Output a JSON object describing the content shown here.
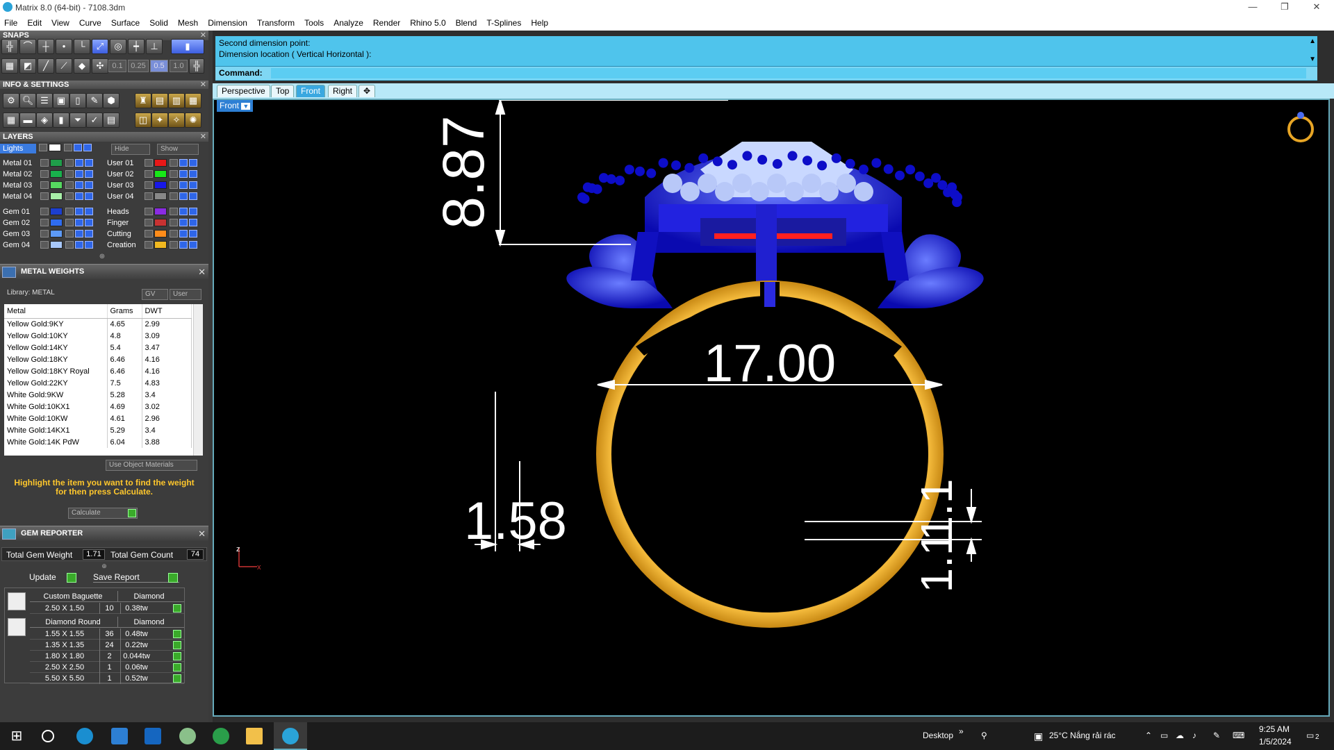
{
  "window": {
    "title": "Matrix 8.0 (64-bit) - 7108.3dm"
  },
  "menu": [
    "File",
    "Edit",
    "View",
    "Curve",
    "Surface",
    "Solid",
    "Mesh",
    "Dimension",
    "Transform",
    "Tools",
    "Analyze",
    "Render",
    "Rhino 5.0",
    "Blend",
    "T-Splines",
    "Help"
  ],
  "snaps": {
    "title": "SNAPS",
    "values": [
      "0.1",
      "0.25",
      "0.5",
      "1.0"
    ]
  },
  "info": {
    "title": "INFO & SETTINGS"
  },
  "layers": {
    "title": "LAYERS",
    "lights": "Lights",
    "hide": "Hide",
    "show": "Show",
    "left": [
      {
        "name": "Metal 01",
        "color": "#1f9e4a"
      },
      {
        "name": "Metal 02",
        "color": "#18b24c"
      },
      {
        "name": "Metal 03",
        "color": "#56d860"
      },
      {
        "name": "Metal 04",
        "color": "#a8f0a8"
      },
      {
        "name": "Gem 01",
        "color": "#1c3fd0"
      },
      {
        "name": "Gem 02",
        "color": "#2f6cf0"
      },
      {
        "name": "Gem 03",
        "color": "#5d9af6"
      },
      {
        "name": "Gem 04",
        "color": "#a8c8fa"
      }
    ],
    "right": [
      {
        "name": "User 01",
        "color": "#e81818"
      },
      {
        "name": "User 02",
        "color": "#18e818"
      },
      {
        "name": "User 03",
        "color": "#1818e8"
      },
      {
        "name": "User 04",
        "color": "#888888"
      },
      {
        "name": "Heads",
        "color": "#8a2be2"
      },
      {
        "name": "Finger",
        "color": "#c83232"
      },
      {
        "name": "Cutting",
        "color": "#ff8c1a"
      },
      {
        "name": "Creation",
        "color": "#f0b820"
      }
    ]
  },
  "metal_weights": {
    "title": "METAL WEIGHTS",
    "library": "Library: METAL",
    "gv": "GV",
    "user": "User",
    "headers": [
      "Metal",
      "Grams",
      "DWT"
    ],
    "rows": [
      [
        "Yellow Gold:9KY",
        "4.65",
        "2.99"
      ],
      [
        "Yellow Gold:10KY",
        "4.8",
        "3.09"
      ],
      [
        "Yellow Gold:14KY",
        "5.4",
        "3.47"
      ],
      [
        "Yellow Gold:18KY",
        "6.46",
        "4.16"
      ],
      [
        "Yellow Gold:18KY Royal",
        "6.46",
        "4.16"
      ],
      [
        "Yellow Gold:22KY",
        "7.5",
        "4.83"
      ],
      [
        "White Gold:9KW",
        "5.28",
        "3.4"
      ],
      [
        "White Gold:10KX1",
        "4.69",
        "3.02"
      ],
      [
        "White Gold:10KW",
        "4.61",
        "2.96"
      ],
      [
        "White Gold:14KX1",
        "5.29",
        "3.4"
      ],
      [
        "White Gold:14K PdW",
        "6.04",
        "3.88"
      ]
    ],
    "use_object_materials": "Use Object Materials",
    "hint": "Highlight the item you want to find the weight for then press Calculate.",
    "calculate": "Calculate"
  },
  "gem_reporter": {
    "title": "GEM REPORTER",
    "total_weight_label": "Total Gem Weight",
    "total_weight": "1.71",
    "total_count_label": "Total Gem Count",
    "total_count": "74",
    "update": "Update",
    "save_report": "Save Report",
    "groups": [
      {
        "shape": "Custom Baguette",
        "material": "Diamond",
        "rows": [
          [
            "2.50 X 1.50",
            "10",
            "0.38tw"
          ]
        ]
      },
      {
        "shape": "Diamond Round",
        "material": "Diamond",
        "rows": [
          [
            "1.55 X 1.55",
            "36",
            "0.48tw"
          ],
          [
            "1.35 X 1.35",
            "24",
            "0.22tw"
          ],
          [
            "1.80 X 1.80",
            "2",
            "0.044tw"
          ],
          [
            "2.50 X 2.50",
            "1",
            "0.06tw"
          ],
          [
            "5.50 X 5.50",
            "1",
            "0.52tw"
          ]
        ]
      }
    ]
  },
  "command": {
    "line1": "Second dimension point:",
    "line2": "Dimension location ( Vertical  Horizontal ):",
    "prompt": "Command:"
  },
  "tabs": [
    "Perspective",
    "Top",
    "Front",
    "Right"
  ],
  "viewport": {
    "label": "Front",
    "dims": {
      "height": "8.87",
      "diameter": "17.00",
      "bottom": "1.58",
      "band1": "1.1",
      "band2": "1.1"
    },
    "axis_z": "z",
    "axis_x": "x",
    "ring_color": "#e7a525",
    "head_color": "#1212d8"
  },
  "taskbar": {
    "desktop": "Desktop",
    "weather": "25°C  Nắng rải rác",
    "time": "9:25 AM",
    "date": "1/5/2024",
    "notifications": "2"
  }
}
